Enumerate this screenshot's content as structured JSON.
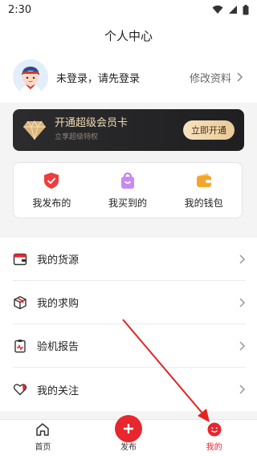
{
  "status_bar": {
    "time": "2:30"
  },
  "header": {
    "title": "个人中心"
  },
  "user": {
    "login_prompt": "未登录，请先登录",
    "edit_profile": "修改资料"
  },
  "vip": {
    "title": "开通超级会员卡",
    "subtitle": "立享超级特权",
    "button": "立即开通"
  },
  "quick_actions": [
    {
      "label": "我发布的",
      "icon": "shield-check-icon"
    },
    {
      "label": "我买到的",
      "icon": "shopping-bag-icon"
    },
    {
      "label": "我的钱包",
      "icon": "wallet-icon"
    }
  ],
  "menu": [
    {
      "label": "我的货源",
      "icon": "wallet-card-icon"
    },
    {
      "label": "我的求购",
      "icon": "package-icon"
    },
    {
      "label": "验机报告",
      "icon": "report-clipboard-icon"
    },
    {
      "label": "我的关注",
      "icon": "heart-icon"
    }
  ],
  "tabs": [
    {
      "label": "首页",
      "icon": "home-icon",
      "active": false
    },
    {
      "label": "发布",
      "icon": "plus-icon",
      "active": false
    },
    {
      "label": "我的",
      "icon": "smile-face-icon",
      "active": true
    }
  ],
  "colors": {
    "accent": "#e8262d",
    "vip_gold": "#f1dcb4",
    "background": "#f4f4f4"
  }
}
